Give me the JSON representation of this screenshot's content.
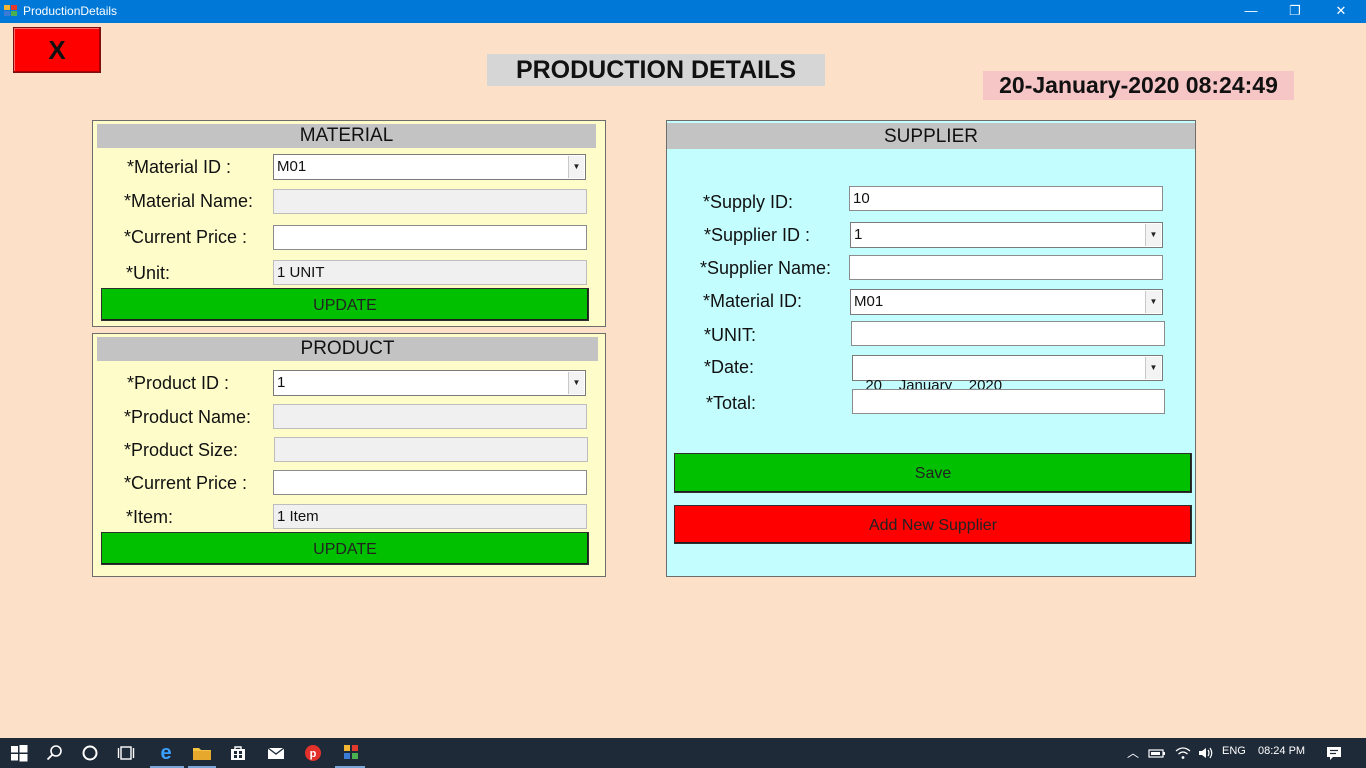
{
  "window": {
    "title": "ProductionDetails",
    "minimize_glyph": "—",
    "maximize_glyph": "❐",
    "close_glyph": "✕"
  },
  "header": {
    "exit_label": "X",
    "page_title": "PRODUCTION DETAILS",
    "datetime": "20-January-2020 08:24:49"
  },
  "material": {
    "title": "MATERIAL",
    "id_label": "*Material ID :",
    "id_value": "M01",
    "name_label": "*Material Name:",
    "name_value": "",
    "price_label": "*Current Price :",
    "price_value": "",
    "unit_label": "*Unit:",
    "unit_value": "1 UNIT",
    "update_label": "UPDATE"
  },
  "product": {
    "title": "PRODUCT",
    "id_label": "*Product ID :",
    "id_value": "1",
    "name_label": "*Product Name:",
    "name_value": "",
    "size_label": "*Product Size:",
    "size_value": "",
    "price_label": "*Current Price :",
    "price_value": "",
    "item_label": "*Item:",
    "item_value": "1 Item",
    "update_label": "UPDATE"
  },
  "supplier": {
    "title": "SUPPLIER",
    "supply_id_label": "*Supply ID:",
    "supply_id_value": "10",
    "supplier_id_label": "*Supplier ID :",
    "supplier_id_value": "1",
    "supplier_name_label": "*Supplier Name:",
    "supplier_name_value": "",
    "material_id_label": "*Material ID:",
    "material_id_value": "M01",
    "unit_label": "*UNIT:",
    "unit_value": "",
    "date_label": "*Date:",
    "date_value": "20    January    2020",
    "total_label": "*Total:",
    "total_value": "",
    "save_label": "Save",
    "add_label": "Add New Supplier"
  },
  "taskbar": {
    "language": "ENG",
    "time": "08:24 PM"
  },
  "colors": {
    "background": "#fde0c8",
    "titlebar": "#0078d7",
    "green_button": "#00c000",
    "red_button": "#fe0000",
    "material_panel": "#fefdca",
    "supplier_panel": "#c4fdfe",
    "panel_header": "#c3c3c3",
    "datetime_bg": "#f6c6c6",
    "taskbar": "#1f2a38"
  },
  "icons": [
    "app-icon",
    "minimize-icon",
    "maximize-icon",
    "window-close-icon",
    "dropdown-arrow-icon",
    "start-icon",
    "search-icon",
    "cortana-icon",
    "task-view-icon",
    "edge-icon",
    "file-explorer-icon",
    "store-icon",
    "mail-icon",
    "psiphon-icon",
    "app-taskbar-icon",
    "tray-chevron-icon",
    "battery-icon",
    "wifi-icon",
    "volume-icon",
    "notification-icon"
  ]
}
